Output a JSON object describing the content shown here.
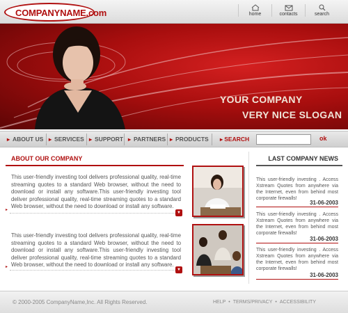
{
  "header": {
    "logo_text": "COMPANYNAME.com",
    "links": [
      {
        "label": "home",
        "icon": "home-icon"
      },
      {
        "label": "contacts",
        "icon": "envelope-icon"
      },
      {
        "label": "search",
        "icon": "magnifier-icon"
      }
    ]
  },
  "banner": {
    "slogan_line1": "YOUR COMPANY",
    "slogan_line2": "VERY NICE SLOGAN"
  },
  "nav": {
    "items": [
      "ABOUT US",
      "SERVICES",
      "SUPPORT",
      "PARTNERS",
      "PRODUCTS"
    ],
    "search_label": "SEARCH",
    "search_value": "",
    "ok_label": "ok"
  },
  "about": {
    "title": "ABOUT OUR COMPANY",
    "paragraphs": [
      "This user-friendly investing tool delivers professional quality, real-time streaming quotes to a standard Web browser, without the need to download or install any software.This user-friendly investing tool deliver professional quality, real-time streaming quotes to a standard Web browser, without the need to download or install any software.",
      "This user-friendly investing tool delivers professional quality, real-time streaming quotes to a standard Web browser, without the need to download or install any software.This user-friendly investing tool deliver professional quality, real-time streaming quotes to a standard Web browser, without the need to download or install any software."
    ]
  },
  "news": {
    "title": "LAST COMPANY NEWS",
    "items": [
      {
        "text": "This user-friendly investing . Access Xstream Quotes from anywhere via the Internet, even from behind most corporate firewalls!",
        "date": "31-06-2003"
      },
      {
        "text": "This user-friendly investing . Access Xstream Quotes from anywhere via the Internet, even from behind most corporate firewalls!",
        "date": "31-06-2003"
      },
      {
        "text": "This user-friendly investing . Access Xstream Quotes from anywhere via the Internet, even from behind most corporate firewalls!",
        "date": "31-06-2003"
      }
    ]
  },
  "footer": {
    "copyright": "© 2000-2005 CompanyName,Inc. All Rights Reserved.",
    "links": [
      "HELP",
      "TERMS/PRIVACY",
      "ACCESSIBILITY"
    ]
  },
  "colors": {
    "accent": "#b01010",
    "banner_dark": "#5c0505",
    "banner_mid": "#a80e0e"
  }
}
